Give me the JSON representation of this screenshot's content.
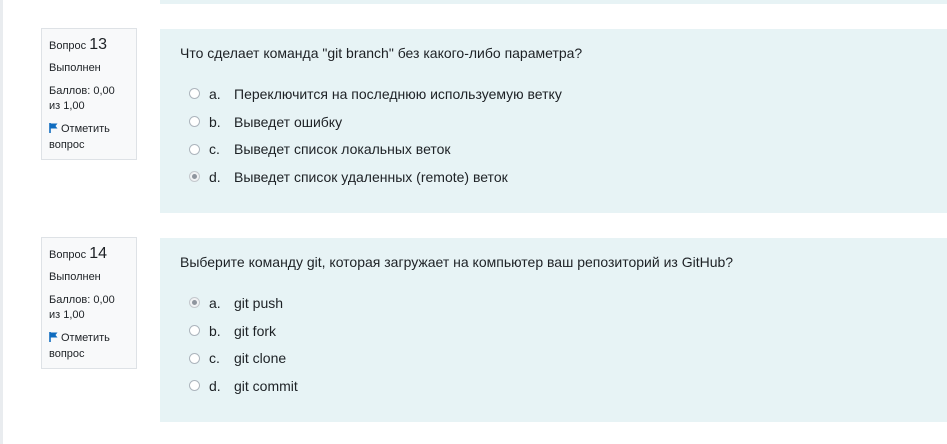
{
  "questions": [
    {
      "label": "Вопрос",
      "number": "13",
      "state": "Выполнен",
      "grade_line1": "Баллов: 0,00",
      "grade_line2": "из 1,00",
      "flag_line1": "Отметить",
      "flag_line2": "вопрос",
      "text": "Что сделает команда \"git branch\" без какого-либо параметра?",
      "answers": [
        {
          "letter": "a.",
          "text": "Переключится на последнюю используемую ветку",
          "checked": false
        },
        {
          "letter": "b.",
          "text": "Выведет ошибку",
          "checked": false
        },
        {
          "letter": "c.",
          "text": "Выведет список локальных веток",
          "checked": false
        },
        {
          "letter": "d.",
          "text": "Выведет список удаленных (remote) веток",
          "checked": true
        }
      ]
    },
    {
      "label": "Вопрос",
      "number": "14",
      "state": "Выполнен",
      "grade_line1": "Баллов: 0,00",
      "grade_line2": "из 1,00",
      "flag_line1": "Отметить",
      "flag_line2": "вопрос",
      "text": "Выберите команду git, которая загружает на компьютер ваш репозиторий из GitHub?",
      "answers": [
        {
          "letter": "a.",
          "text": "git push",
          "checked": true
        },
        {
          "letter": "b.",
          "text": "git fork",
          "checked": false
        },
        {
          "letter": "c.",
          "text": "git clone",
          "checked": false
        },
        {
          "letter": "d.",
          "text": "git commit",
          "checked": false
        }
      ]
    }
  ],
  "colors": {
    "content_bg": "#e7f3f5",
    "info_bg": "#f8f9fa",
    "flag": "#0f6cbf"
  }
}
